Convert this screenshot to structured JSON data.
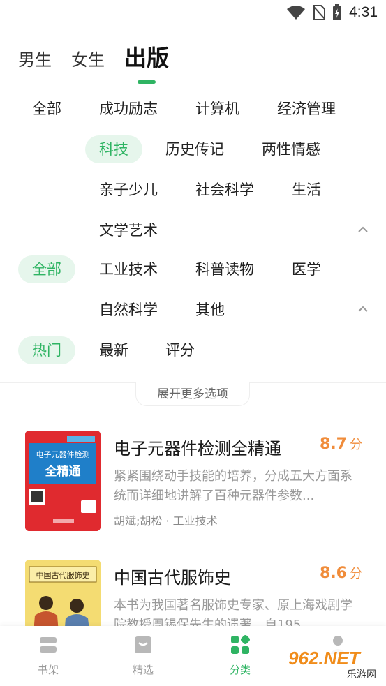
{
  "status_bar": {
    "time": "4:31"
  },
  "gender_tabs": [
    {
      "label": "男生"
    },
    {
      "label": "女生"
    },
    {
      "label": "出版"
    }
  ],
  "category_row": [
    "全部",
    "成功励志",
    "计算机",
    "经济管理",
    "科技",
    "历史传记",
    "两性情感",
    "亲子少儿",
    "社会科学",
    "生活",
    "文学艺术"
  ],
  "status_row": [
    "全部",
    "工业技术",
    "科普读物",
    "医学",
    "自然科学",
    "其他"
  ],
  "sort_row": [
    "热门",
    "最新",
    "评分"
  ],
  "expand_label": "展开更多选项",
  "books": [
    {
      "title": "电子元器件检测全精通",
      "score": "8.7",
      "score_unit": "分",
      "desc": "紧紧围绕动手技能的培养，分成五大方面系统而详细地讲解了百种元器件参数...",
      "meta": "胡斌;胡松 · 工业技术",
      "cover_text": [
        "电子元器件检测",
        "全精通"
      ]
    },
    {
      "title": "中国古代服饰史",
      "score": "8.6",
      "score_unit": "分",
      "desc": "本书为我国著名服饰史专家、原上海戏剧学院教授周锡保先生的遗著，自195",
      "meta": "",
      "cover_text": [
        "中国古代服饰史"
      ]
    }
  ],
  "bottom_nav": [
    {
      "label": "书架",
      "icon": "bookshelf-icon"
    },
    {
      "label": "精选",
      "icon": "featured-icon"
    },
    {
      "label": "分类",
      "icon": "category-icon"
    },
    {
      "label": "",
      "icon": "profile-icon"
    }
  ],
  "watermark": {
    "text": "962.NET",
    "sub": "乐游网"
  },
  "colors": {
    "accent": "#2fb463",
    "score": "#f08c3a"
  }
}
